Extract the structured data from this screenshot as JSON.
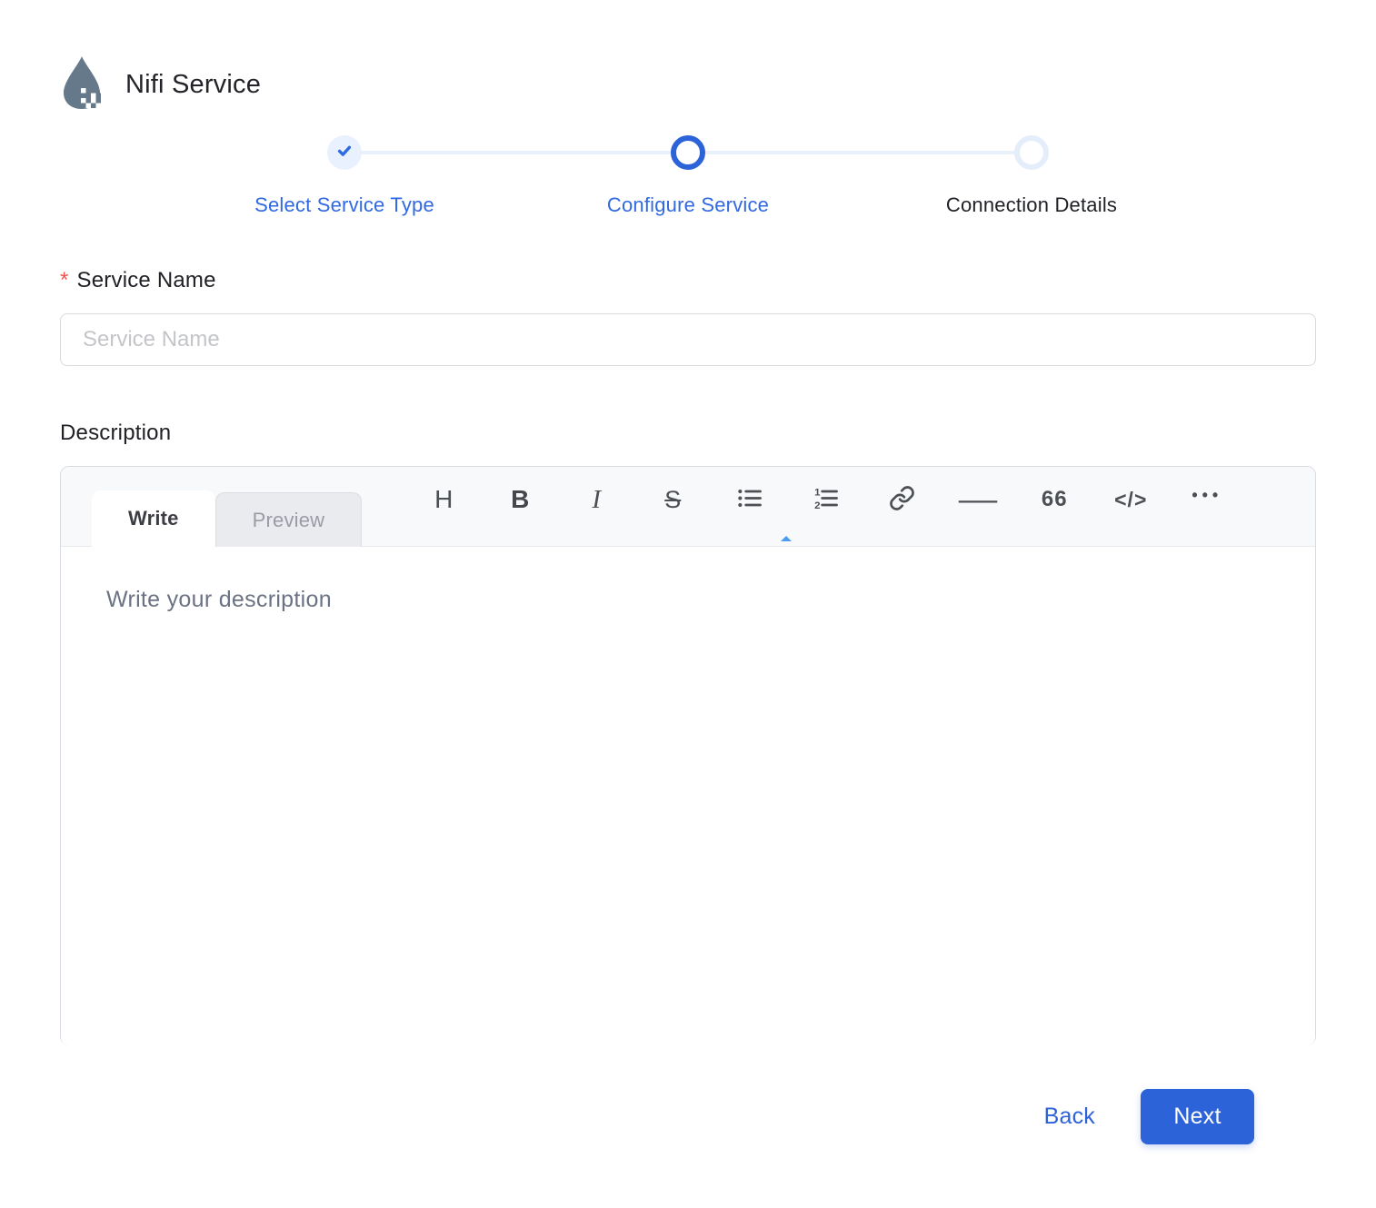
{
  "header": {
    "title": "Nifi Service",
    "logo_icon": "nifi-drop-icon",
    "logo_color": "#66798b"
  },
  "stepper": {
    "steps": [
      {
        "label": "Select Service Type",
        "state": "completed",
        "icon": "check-icon"
      },
      {
        "label": "Configure Service",
        "state": "active"
      },
      {
        "label": "Connection Details",
        "state": "upcoming"
      }
    ],
    "colors": {
      "accent": "#2d63d9",
      "completed_bg": "#e8f1fd",
      "connector_line": "#e9f1fc",
      "active_label": "#3069e1",
      "upcoming_label": "#1f2026"
    }
  },
  "form": {
    "service_name": {
      "required_marker": "*",
      "label": "Service Name",
      "placeholder": "Service Name",
      "value": ""
    },
    "description": {
      "label": "Description"
    }
  },
  "editor": {
    "tabs": [
      {
        "label": "Write",
        "active": true
      },
      {
        "label": "Preview",
        "active": false
      }
    ],
    "toolbar": [
      {
        "name": "heading",
        "glyph": "H"
      },
      {
        "name": "bold",
        "glyph": "B"
      },
      {
        "name": "italic",
        "glyph": "I"
      },
      {
        "name": "strikethrough",
        "glyph": "S"
      },
      {
        "name": "unordered-list",
        "glyph": ""
      },
      {
        "name": "ordered-list",
        "glyph": ""
      },
      {
        "name": "link",
        "glyph": ""
      },
      {
        "name": "horizontal-rule",
        "glyph": "—"
      },
      {
        "name": "quote",
        "glyph": "66"
      },
      {
        "name": "code",
        "glyph": "</>"
      },
      {
        "name": "more",
        "glyph": "•••"
      }
    ],
    "placeholder": "Write your description",
    "value": ""
  },
  "footer": {
    "back_label": "Back",
    "next_label": "Next",
    "next_bg": "#2d63d8",
    "link_color": "#2e62d9"
  }
}
